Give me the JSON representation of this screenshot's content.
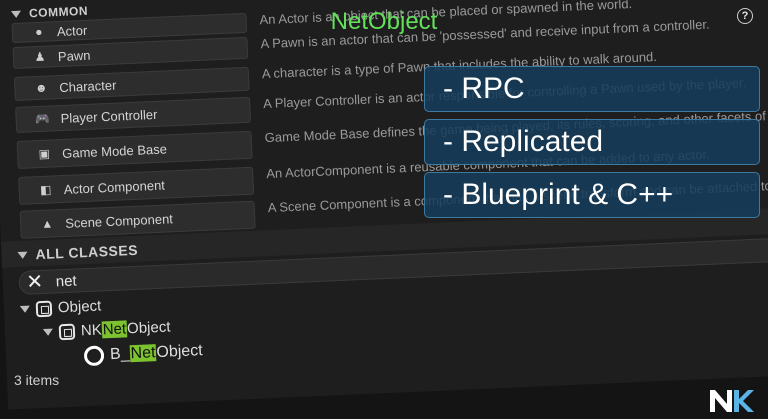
{
  "title": "NetObject",
  "common": {
    "header": "COMMON",
    "items": [
      {
        "label": "Actor",
        "icon": "actor-icon",
        "desc": "An Actor is an object that can be placed or spawned in the world."
      },
      {
        "label": "Pawn",
        "icon": "pawn-icon",
        "desc": "A Pawn is an actor that can be 'possessed' and receive input from a controller."
      },
      {
        "label": "Character",
        "icon": "character-icon",
        "desc": "A character is a type of Pawn that includes the ability to walk around."
      },
      {
        "label": "Player Controller",
        "icon": "gamepad-icon",
        "desc": "A Player Controller is an actor responsible for controlling a Pawn used by the player."
      },
      {
        "label": "Game Mode Base",
        "icon": "gamemode-icon",
        "desc": "Game Mode Base defines the game being played, its rules, scoring, and other facets of the game type."
      },
      {
        "label": "Actor Component",
        "icon": "component-icon",
        "desc": "An ActorComponent is a reusable component that can be added to any actor."
      },
      {
        "label": "Scene Component",
        "icon": "scene-component-icon",
        "desc": "A Scene Component is a component that has a scene transform and can be attached to other scene components."
      }
    ]
  },
  "all_classes": {
    "header": "ALL CLASSES",
    "search_value": "net",
    "tree": [
      {
        "pre": "Object",
        "match": "",
        "post": ""
      },
      {
        "pre": "NK",
        "match": "Net",
        "post": "Object"
      },
      {
        "pre": "B_",
        "match": "Net",
        "post": "Object"
      }
    ],
    "count": "3 items"
  },
  "features": [
    "- RPC",
    "- Replicated",
    "- Blueprint & C++"
  ],
  "logo_text": "NK",
  "colors": {
    "title": "#63e05a",
    "highlight": "#7cc32f",
    "feature_bg": "#163c5a"
  }
}
